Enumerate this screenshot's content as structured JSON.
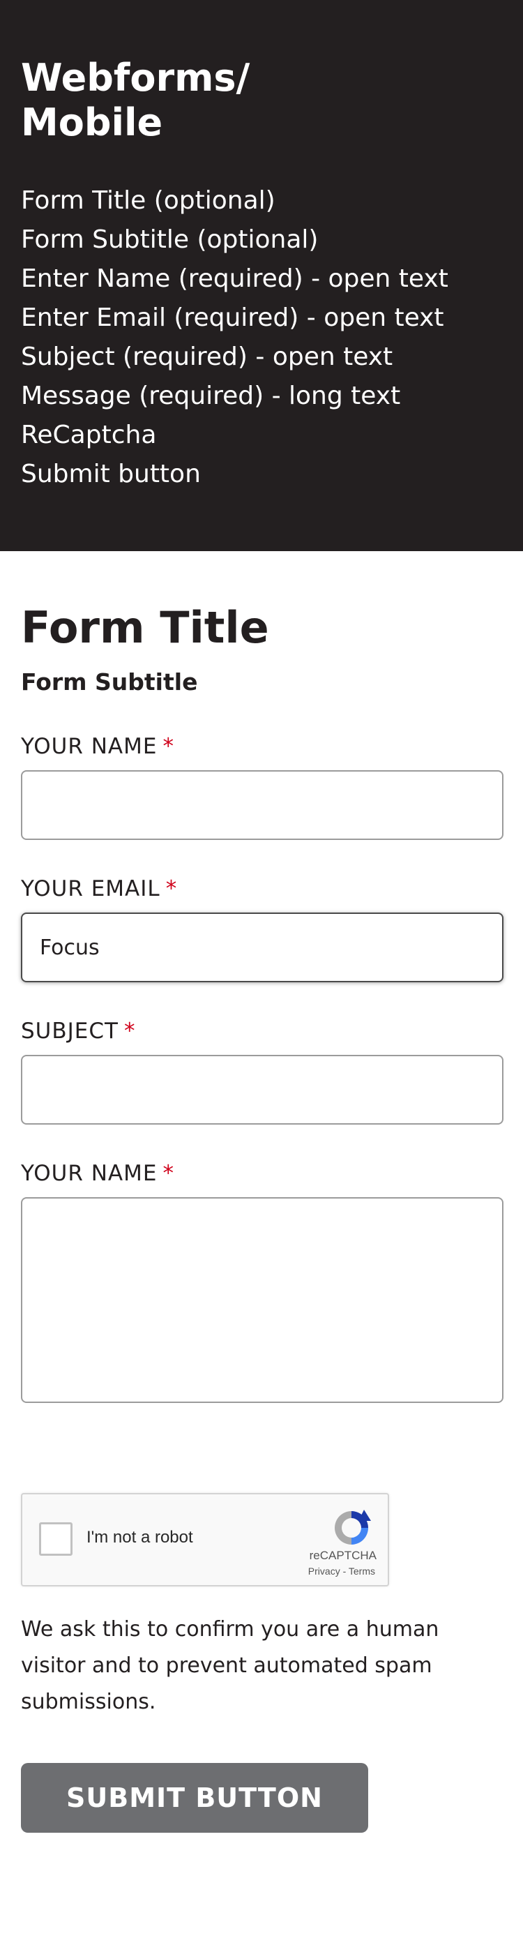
{
  "spec": {
    "title": "Webforms/ Mobile",
    "items": [
      "Form Title (optional)",
      "Form Subtitle (optional)",
      "Enter Name (required) - open text",
      "Enter Email (required) - open text",
      "Subject (required) - open text",
      "Message (required) - long text",
      "ReCaptcha",
      "Submit button"
    ]
  },
  "form": {
    "title": "Form Title",
    "subtitle": "Form Subtitle",
    "required_mark": "*",
    "fields": {
      "name": {
        "label": "YOUR NAME",
        "value": ""
      },
      "email": {
        "label": "YOUR EMAIL",
        "value": "Focus"
      },
      "subject": {
        "label": "SUBJECT",
        "value": ""
      },
      "message": {
        "label": "YOUR NAME",
        "value": ""
      }
    },
    "recaptcha": {
      "checkbox_label": "I'm not a robot",
      "brand": "reCAPTCHA",
      "links": "Privacy - Terms"
    },
    "note": "We ask this to confirm you are a human visitor and to prevent automated spam submissions.",
    "submit_label": "SUBMIT BUTTON"
  },
  "colors": {
    "dark_bg": "#231f20",
    "required": "#d0021b",
    "button_bg": "#6d6e71"
  }
}
